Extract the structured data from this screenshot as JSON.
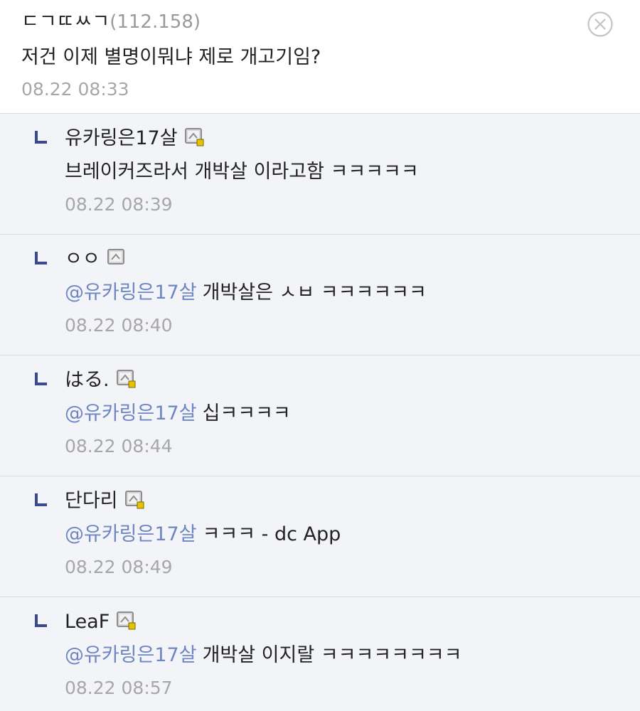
{
  "top_comment": {
    "author": "ㄷㄱㄸㅆㄱ",
    "ip": "(112.158)",
    "text": "저건 이제 별명이뭐냐 제로 개고기임?",
    "time": "08.22 08:33"
  },
  "close_icon": "close-circle-icon",
  "colors": {
    "mention": "#6e86c2",
    "reply_bg": "#f3f4f8",
    "timestamp": "#a7a7a7",
    "reply_arrow": "#3b4a8f"
  },
  "replies": [
    {
      "author": "유카링은17살",
      "icon": "member-badge-icon",
      "mention": "",
      "text": "브레이커즈라서 개박살 이라고함 ㅋㅋㅋㅋㅋ",
      "time": "08.22 08:39"
    },
    {
      "author": "ㅇㅇ",
      "icon": "member-badge-icon",
      "mention": "@유카링은17살",
      "text": "개박살은 ㅅㅂ ㅋㅋㅋㅋㅋㅋ",
      "time": "08.22 08:40"
    },
    {
      "author": "はる.",
      "icon": "member-badge-icon",
      "mention": "@유카링은17살",
      "text": "십ㅋㅋㅋㅋ",
      "time": "08.22 08:44"
    },
    {
      "author": "단다리",
      "icon": "member-badge-icon",
      "mention": "@유카링은17살",
      "text": "ㅋㅋㅋ - dc App",
      "time": "08.22 08:49"
    },
    {
      "author": "LeaF",
      "icon": "member-badge-icon",
      "mention": "@유카링은17살",
      "text": "개박살 이지랄 ㅋㅋㅋㅋㅋㅋㅋㅋ",
      "time": "08.22 08:57"
    }
  ]
}
